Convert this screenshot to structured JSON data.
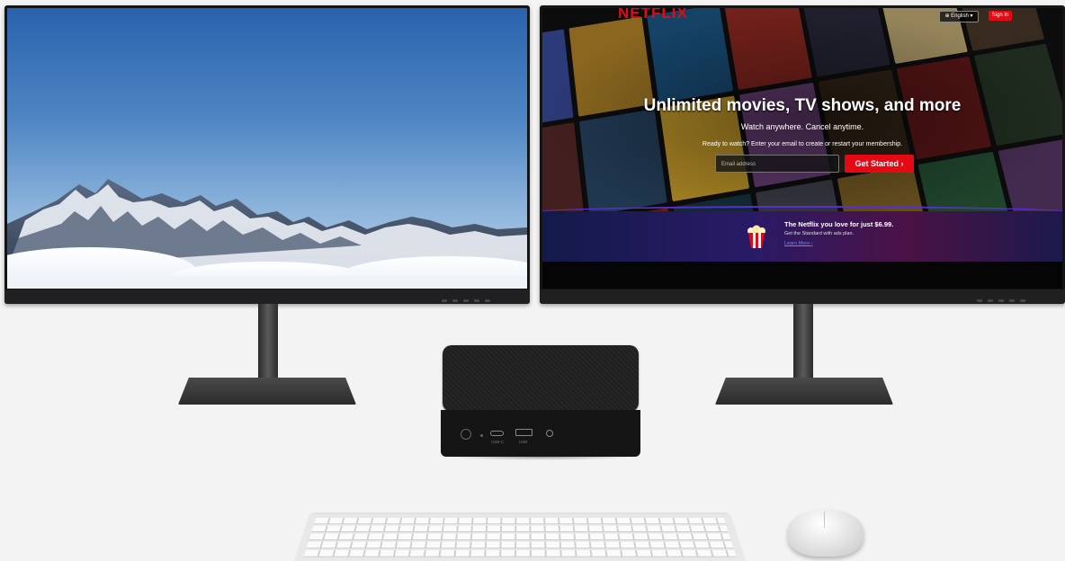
{
  "left_monitor": {
    "wallpaper": "mountain-landscape",
    "colors": {
      "sky_top": "#2a63ad",
      "snow": "#e9eef4",
      "rock": "#4a5a73"
    }
  },
  "right_monitor": {
    "netflix": {
      "logo_text": "NETFLIX",
      "language_button": "English",
      "sign_in_button": "Sign In",
      "headline": "Unlimited movies, TV shows, and more",
      "subheadline": "Watch anywhere. Cancel anytime.",
      "cta_text": "Ready to watch? Enter your email to create or restart your membership.",
      "email_placeholder": "Email address",
      "get_started_button": "Get Started",
      "promo": {
        "title": "The Netflix you love for just $6.99.",
        "subtitle": "Get the Standard with ads plan.",
        "link": "Learn More"
      },
      "colors": {
        "brand_red": "#e50914",
        "link_blue": "#5c8cff"
      }
    }
  },
  "mini_pc": {
    "ports": [
      "power-button",
      "led",
      "usb-c",
      "usb-a",
      "audio-jack"
    ],
    "port_labels": [
      "USB-C",
      "USB"
    ]
  },
  "peripherals": {
    "keyboard": "wireless-keyboard",
    "mouse": "wireless-mouse"
  }
}
